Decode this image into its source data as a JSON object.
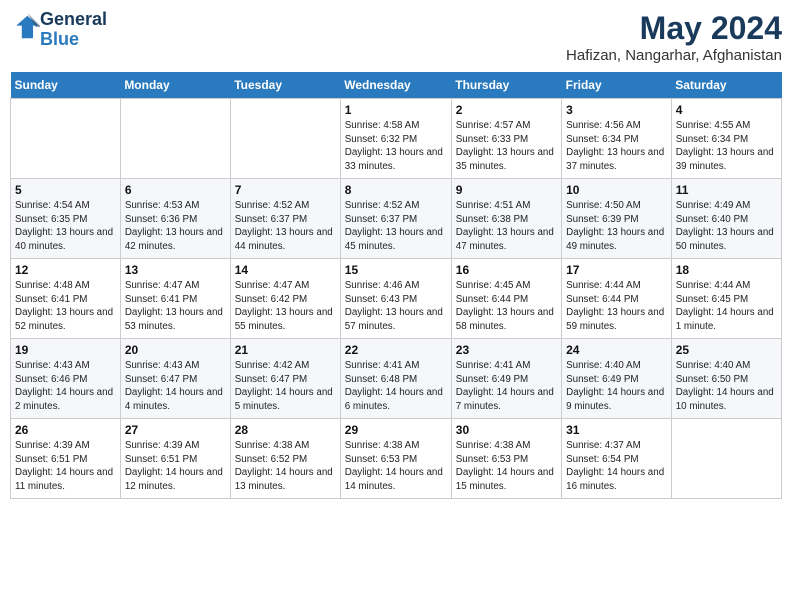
{
  "header": {
    "logo_line1": "General",
    "logo_line2": "Blue",
    "month_title": "May 2024",
    "location": "Hafizan, Nangarhar, Afghanistan"
  },
  "weekdays": [
    "Sunday",
    "Monday",
    "Tuesday",
    "Wednesday",
    "Thursday",
    "Friday",
    "Saturday"
  ],
  "weeks": [
    [
      {
        "day": "",
        "info": ""
      },
      {
        "day": "",
        "info": ""
      },
      {
        "day": "",
        "info": ""
      },
      {
        "day": "1",
        "info": "Sunrise: 4:58 AM\nSunset: 6:32 PM\nDaylight: 13 hours and 33 minutes."
      },
      {
        "day": "2",
        "info": "Sunrise: 4:57 AM\nSunset: 6:33 PM\nDaylight: 13 hours and 35 minutes."
      },
      {
        "day": "3",
        "info": "Sunrise: 4:56 AM\nSunset: 6:34 PM\nDaylight: 13 hours and 37 minutes."
      },
      {
        "day": "4",
        "info": "Sunrise: 4:55 AM\nSunset: 6:34 PM\nDaylight: 13 hours and 39 minutes."
      }
    ],
    [
      {
        "day": "5",
        "info": "Sunrise: 4:54 AM\nSunset: 6:35 PM\nDaylight: 13 hours and 40 minutes."
      },
      {
        "day": "6",
        "info": "Sunrise: 4:53 AM\nSunset: 6:36 PM\nDaylight: 13 hours and 42 minutes."
      },
      {
        "day": "7",
        "info": "Sunrise: 4:52 AM\nSunset: 6:37 PM\nDaylight: 13 hours and 44 minutes."
      },
      {
        "day": "8",
        "info": "Sunrise: 4:52 AM\nSunset: 6:37 PM\nDaylight: 13 hours and 45 minutes."
      },
      {
        "day": "9",
        "info": "Sunrise: 4:51 AM\nSunset: 6:38 PM\nDaylight: 13 hours and 47 minutes."
      },
      {
        "day": "10",
        "info": "Sunrise: 4:50 AM\nSunset: 6:39 PM\nDaylight: 13 hours and 49 minutes."
      },
      {
        "day": "11",
        "info": "Sunrise: 4:49 AM\nSunset: 6:40 PM\nDaylight: 13 hours and 50 minutes."
      }
    ],
    [
      {
        "day": "12",
        "info": "Sunrise: 4:48 AM\nSunset: 6:41 PM\nDaylight: 13 hours and 52 minutes."
      },
      {
        "day": "13",
        "info": "Sunrise: 4:47 AM\nSunset: 6:41 PM\nDaylight: 13 hours and 53 minutes."
      },
      {
        "day": "14",
        "info": "Sunrise: 4:47 AM\nSunset: 6:42 PM\nDaylight: 13 hours and 55 minutes."
      },
      {
        "day": "15",
        "info": "Sunrise: 4:46 AM\nSunset: 6:43 PM\nDaylight: 13 hours and 57 minutes."
      },
      {
        "day": "16",
        "info": "Sunrise: 4:45 AM\nSunset: 6:44 PM\nDaylight: 13 hours and 58 minutes."
      },
      {
        "day": "17",
        "info": "Sunrise: 4:44 AM\nSunset: 6:44 PM\nDaylight: 13 hours and 59 minutes."
      },
      {
        "day": "18",
        "info": "Sunrise: 4:44 AM\nSunset: 6:45 PM\nDaylight: 14 hours and 1 minute."
      }
    ],
    [
      {
        "day": "19",
        "info": "Sunrise: 4:43 AM\nSunset: 6:46 PM\nDaylight: 14 hours and 2 minutes."
      },
      {
        "day": "20",
        "info": "Sunrise: 4:43 AM\nSunset: 6:47 PM\nDaylight: 14 hours and 4 minutes."
      },
      {
        "day": "21",
        "info": "Sunrise: 4:42 AM\nSunset: 6:47 PM\nDaylight: 14 hours and 5 minutes."
      },
      {
        "day": "22",
        "info": "Sunrise: 4:41 AM\nSunset: 6:48 PM\nDaylight: 14 hours and 6 minutes."
      },
      {
        "day": "23",
        "info": "Sunrise: 4:41 AM\nSunset: 6:49 PM\nDaylight: 14 hours and 7 minutes."
      },
      {
        "day": "24",
        "info": "Sunrise: 4:40 AM\nSunset: 6:49 PM\nDaylight: 14 hours and 9 minutes."
      },
      {
        "day": "25",
        "info": "Sunrise: 4:40 AM\nSunset: 6:50 PM\nDaylight: 14 hours and 10 minutes."
      }
    ],
    [
      {
        "day": "26",
        "info": "Sunrise: 4:39 AM\nSunset: 6:51 PM\nDaylight: 14 hours and 11 minutes."
      },
      {
        "day": "27",
        "info": "Sunrise: 4:39 AM\nSunset: 6:51 PM\nDaylight: 14 hours and 12 minutes."
      },
      {
        "day": "28",
        "info": "Sunrise: 4:38 AM\nSunset: 6:52 PM\nDaylight: 14 hours and 13 minutes."
      },
      {
        "day": "29",
        "info": "Sunrise: 4:38 AM\nSunset: 6:53 PM\nDaylight: 14 hours and 14 minutes."
      },
      {
        "day": "30",
        "info": "Sunrise: 4:38 AM\nSunset: 6:53 PM\nDaylight: 14 hours and 15 minutes."
      },
      {
        "day": "31",
        "info": "Sunrise: 4:37 AM\nSunset: 6:54 PM\nDaylight: 14 hours and 16 minutes."
      },
      {
        "day": "",
        "info": ""
      }
    ]
  ]
}
